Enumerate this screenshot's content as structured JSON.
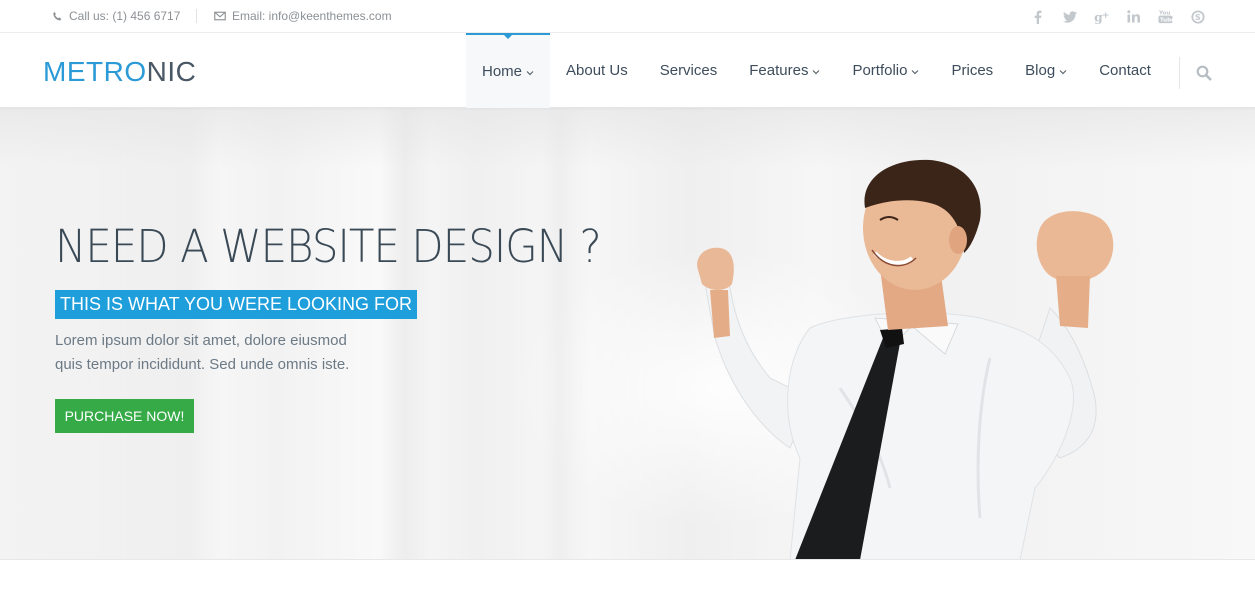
{
  "topbar": {
    "phone": "Call us: (1) 456 6717",
    "email": "Email: info@keenthemes.com",
    "socials": [
      {
        "icon": "facebook-icon",
        "glyph": "f"
      },
      {
        "icon": "twitter-icon",
        "glyph": "t"
      },
      {
        "icon": "google-plus-icon",
        "glyph": "g+"
      },
      {
        "icon": "linkedin-icon",
        "glyph": "in"
      },
      {
        "icon": "youtube-icon",
        "glyph": "You"
      },
      {
        "icon": "skype-icon",
        "glyph": "S"
      }
    ]
  },
  "header": {
    "logo_part1": "METRO",
    "logo_part2": "NIC",
    "nav": [
      {
        "label": "Home",
        "dropdown": true,
        "active": true
      },
      {
        "label": "About Us",
        "dropdown": false
      },
      {
        "label": "Services",
        "dropdown": false
      },
      {
        "label": "Features",
        "dropdown": true
      },
      {
        "label": "Portfolio",
        "dropdown": true
      },
      {
        "label": "Prices",
        "dropdown": false
      },
      {
        "label": "Blog",
        "dropdown": true
      },
      {
        "label": "Contact",
        "dropdown": false
      }
    ]
  },
  "hero": {
    "title": "NEED A WEBSITE DESIGN ?",
    "subtitle": "THIS IS WHAT YOU WERE LOOKING FOR",
    "text_line1": "Lorem ipsum dolor sit amet, dolore eiusmod",
    "text_line2": "quis tempor incididunt. Sed unde omnis iste.",
    "cta": "PURCHASE NOW!"
  },
  "colors": {
    "accent": "#2b9ad6",
    "subtitle_bg": "#1e9edb",
    "cta_bg": "#35aa47"
  }
}
